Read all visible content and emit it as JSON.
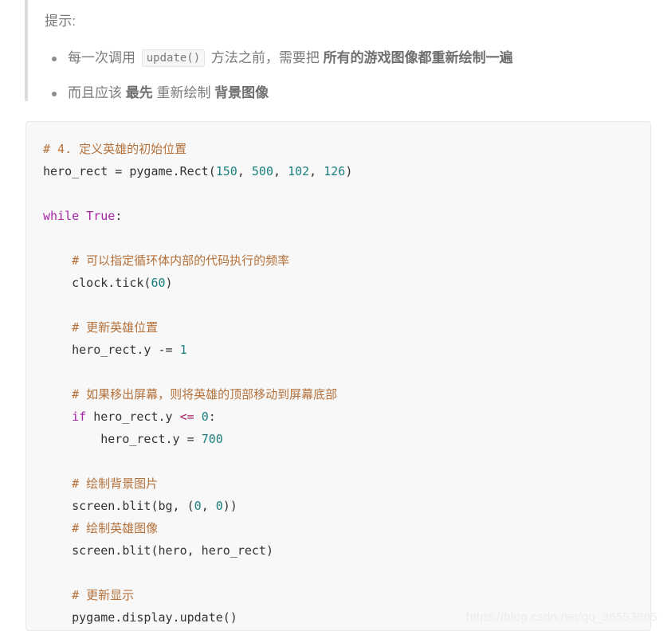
{
  "tip": {
    "title": "提示:",
    "items": [
      {
        "parts": [
          {
            "type": "text",
            "value": "每一次调用 "
          },
          {
            "type": "code",
            "value": "update()"
          },
          {
            "type": "text",
            "value": " 方法之前，需要把 "
          },
          {
            "type": "bold",
            "value": "所有的游戏图像都重新绘制一遍"
          }
        ]
      },
      {
        "parts": [
          {
            "type": "text",
            "value": "而且应该 "
          },
          {
            "type": "bold",
            "value": "最先"
          },
          {
            "type": "text",
            "value": " 重新绘制 "
          },
          {
            "type": "bold",
            "value": "背景图像"
          }
        ]
      }
    ]
  },
  "code_block": {
    "language": "python",
    "lines": [
      [
        {
          "t": "comment",
          "v": "# 4. 定义英雄的初始位置"
        }
      ],
      [
        {
          "t": "plain",
          "v": "hero_rect = pygame.Rect("
        },
        {
          "t": "number",
          "v": "150"
        },
        {
          "t": "plain",
          "v": ", "
        },
        {
          "t": "number",
          "v": "500"
        },
        {
          "t": "plain",
          "v": ", "
        },
        {
          "t": "number",
          "v": "102"
        },
        {
          "t": "plain",
          "v": ", "
        },
        {
          "t": "number",
          "v": "126"
        },
        {
          "t": "plain",
          "v": ")"
        }
      ],
      [],
      [
        {
          "t": "keyword",
          "v": "while"
        },
        {
          "t": "plain",
          "v": " "
        },
        {
          "t": "keyword",
          "v": "True"
        },
        {
          "t": "plain",
          "v": ":"
        }
      ],
      [],
      [
        {
          "t": "comment",
          "v": "    # 可以指定循环体内部的代码执行的频率"
        }
      ],
      [
        {
          "t": "plain",
          "v": "    clock.tick("
        },
        {
          "t": "number",
          "v": "60"
        },
        {
          "t": "plain",
          "v": ")"
        }
      ],
      [],
      [
        {
          "t": "comment",
          "v": "    # 更新英雄位置"
        }
      ],
      [
        {
          "t": "plain",
          "v": "    hero_rect.y "
        },
        {
          "t": "operator",
          "v": "-="
        },
        {
          "t": "plain",
          "v": " "
        },
        {
          "t": "number",
          "v": "1"
        }
      ],
      [],
      [
        {
          "t": "comment",
          "v": "    # 如果移出屏幕，则将英雄的顶部移动到屏幕底部"
        }
      ],
      [
        {
          "t": "keyword",
          "v": "    if"
        },
        {
          "t": "plain",
          "v": " hero_rect.y "
        },
        {
          "t": "op-pink",
          "v": "<="
        },
        {
          "t": "plain",
          "v": " "
        },
        {
          "t": "number",
          "v": "0"
        },
        {
          "t": "plain",
          "v": ":"
        }
      ],
      [
        {
          "t": "plain",
          "v": "        hero_rect.y = "
        },
        {
          "t": "number",
          "v": "700"
        }
      ],
      [],
      [
        {
          "t": "comment",
          "v": "    # 绘制背景图片"
        }
      ],
      [
        {
          "t": "plain",
          "v": "    screen.blit(bg, ("
        },
        {
          "t": "number",
          "v": "0"
        },
        {
          "t": "plain",
          "v": ", "
        },
        {
          "t": "number",
          "v": "0"
        },
        {
          "t": "plain",
          "v": "))"
        }
      ],
      [
        {
          "t": "comment",
          "v": "    # 绘制英雄图像"
        }
      ],
      [
        {
          "t": "plain",
          "v": "    screen.blit(hero, hero_rect)"
        }
      ],
      [],
      [
        {
          "t": "comment",
          "v": "    # 更新显示"
        }
      ],
      [
        {
          "t": "plain",
          "v": "    pygame.display.update()"
        }
      ]
    ]
  },
  "watermark": {
    "text": "https://blog.csdn.net/qq_36553865"
  }
}
